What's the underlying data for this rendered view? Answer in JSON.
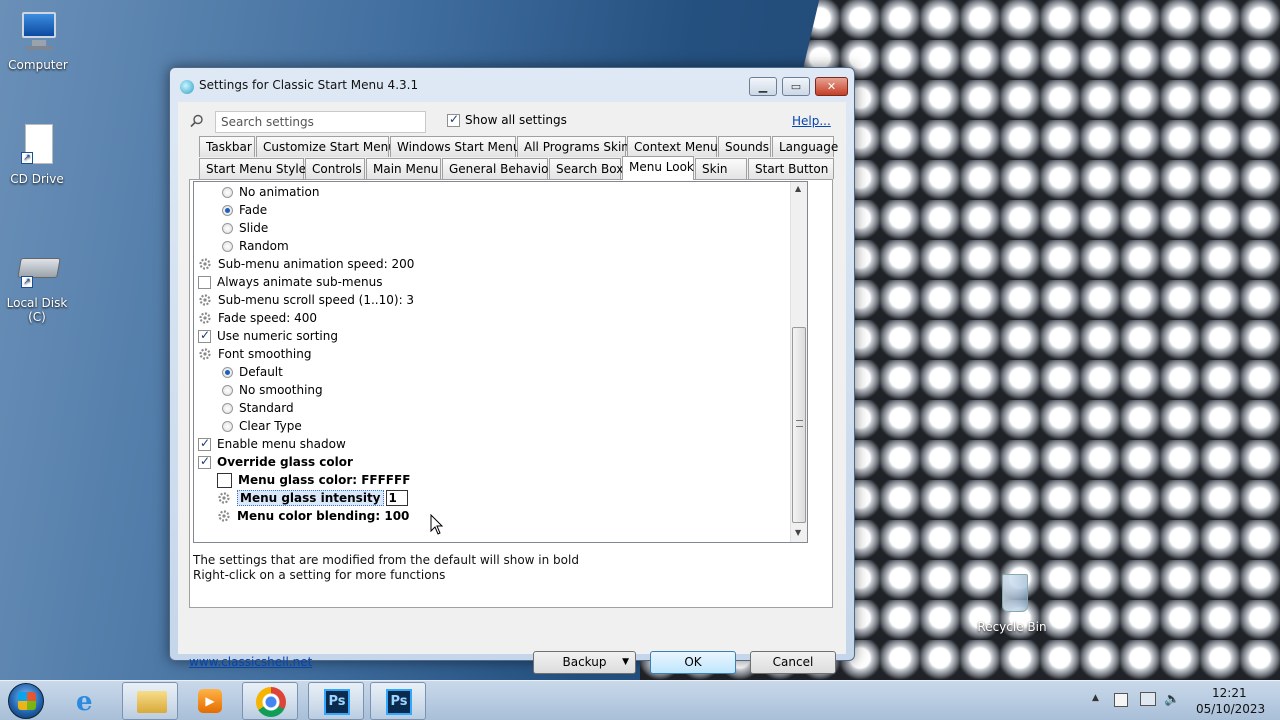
{
  "desktop": {
    "icons": [
      {
        "label": "Computer"
      },
      {
        "label": "CD Drive"
      },
      {
        "label": "Local Disk (C)"
      },
      {
        "label": "Recycle Bin"
      }
    ]
  },
  "window": {
    "title": "Settings for Classic Start Menu 4.3.1",
    "search_placeholder": "Search settings",
    "show_all_label": "Show all settings",
    "show_all_checked": true,
    "help_label": "Help...",
    "tabs_row1": [
      "Taskbar",
      "Customize Start Menu",
      "Windows Start Menu",
      "All Programs Skin",
      "Context Menu",
      "Sounds",
      "Language"
    ],
    "tabs_row2": [
      "Start Menu Style",
      "Controls",
      "Main Menu",
      "General Behavior",
      "Search Box",
      "Menu Look",
      "Skin",
      "Start Button"
    ],
    "active_tab": "Menu Look",
    "settings": [
      {
        "kind": "radio",
        "label": "No animation",
        "checked": false
      },
      {
        "kind": "radio",
        "label": "Fade",
        "checked": true
      },
      {
        "kind": "radio",
        "label": "Slide",
        "checked": false
      },
      {
        "kind": "radio",
        "label": "Random",
        "checked": false
      },
      {
        "kind": "gear",
        "label": "Sub-menu animation speed: 200"
      },
      {
        "kind": "check",
        "label": "Always animate sub-menus",
        "checked": false
      },
      {
        "kind": "gear",
        "label": "Sub-menu scroll speed (1..10): 3"
      },
      {
        "kind": "gear",
        "label": "Fade speed: 400"
      },
      {
        "kind": "check",
        "label": "Use numeric sorting",
        "checked": true
      },
      {
        "kind": "gear",
        "label": "Font smoothing"
      },
      {
        "kind": "radio",
        "label": "Default",
        "checked": true
      },
      {
        "kind": "radio",
        "label": "No smoothing",
        "checked": false
      },
      {
        "kind": "radio",
        "label": "Standard",
        "checked": false
      },
      {
        "kind": "radio",
        "label": "Clear Type",
        "checked": false
      },
      {
        "kind": "check",
        "label": "Enable menu shadow",
        "checked": true
      },
      {
        "kind": "check",
        "label": "Override glass color",
        "checked": true
      },
      {
        "kind": "color",
        "label": "Menu glass color: FFFFFF"
      },
      {
        "kind": "gear-edit",
        "label": "Menu glass intensity",
        "edit_value": "1"
      },
      {
        "kind": "gear",
        "label": "Menu color blending: 100"
      }
    ],
    "hint_line1": "The settings that are modified from the default will show in bold",
    "hint_line2": "Right-click on a setting for more functions",
    "footer_link": "www.classicshell.net",
    "backup_label": "Backup",
    "ok_label": "OK",
    "cancel_label": "Cancel"
  },
  "taskbar": {
    "time": "12:21",
    "date": "05/10/2023"
  }
}
